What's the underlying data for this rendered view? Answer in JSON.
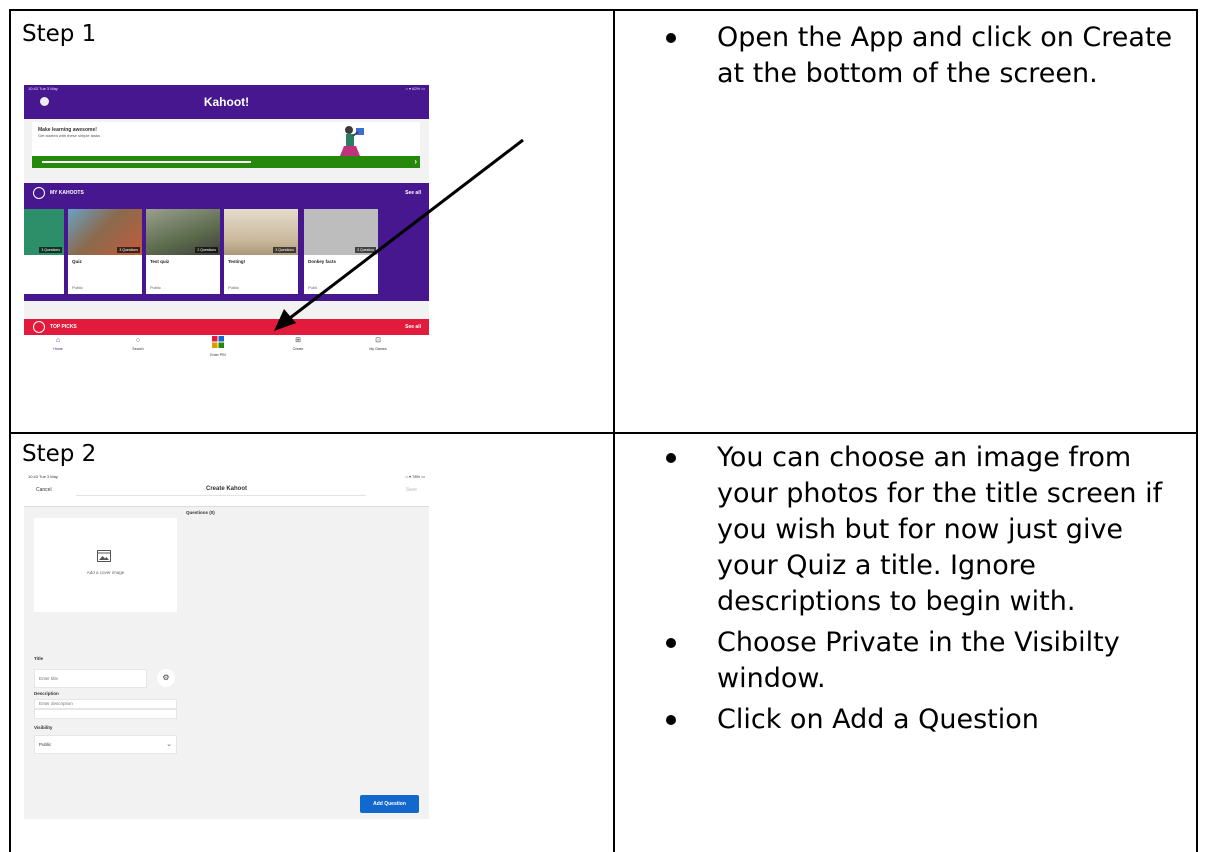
{
  "steps": [
    {
      "label": "Step 1",
      "bullets": [
        "Open the App and click on Create at the bottom of the screen."
      ]
    },
    {
      "label": "Step 2",
      "bullets": [
        "You can choose an image from your photos for the title screen if you wish but for now just give your Quiz a title. Ignore descriptions to begin with.",
        "Choose Private in the Visibilty window.",
        "Click on Add a Question"
      ]
    }
  ],
  "shot1": {
    "status_time": "10:43  Tue 3 May",
    "status_right": "⌂ ▾ 62% ▭",
    "logo": "Kahoot!",
    "card_title": "Make learning awesome!",
    "card_subtitle": "Get started with these simple tasks",
    "progress": 0.58,
    "section_title": "MY KAHOOTS",
    "see_all": "See all",
    "tiles": [
      {
        "name": "",
        "badge": "3 Questions",
        "visibility": "",
        "color": "#2c8f6a"
      },
      {
        "name": "Quiz",
        "badge": "3 Questions",
        "visibility": "Public",
        "color": "#8a6a4d"
      },
      {
        "name": "Test quiz",
        "badge": "2 Questions",
        "visibility": "Public",
        "color": "#6f7565"
      },
      {
        "name": "Testing!",
        "badge": "3 Questions",
        "visibility": "Public",
        "color": "#c9b79a"
      },
      {
        "name": "Donkey facts",
        "badge": "3 Question",
        "visibility": "Publi",
        "color": "#bdbdbd"
      }
    ],
    "top_picks_title": "TOP PICKS",
    "top_picks_see_all": "See all",
    "nav": [
      {
        "label": "Home",
        "icon": "home-icon",
        "glyph": "⌂"
      },
      {
        "label": "Search",
        "icon": "search-icon",
        "glyph": "○"
      },
      {
        "label": "Enter PIN",
        "icon": "pin-icon",
        "glyph": "■"
      },
      {
        "label": "Create",
        "icon": "create-icon",
        "glyph": "⊞"
      },
      {
        "label": "My Games",
        "icon": "games-icon",
        "glyph": "⊡"
      }
    ]
  },
  "shot2": {
    "status_time": "10:43  Tue 3 May",
    "status_right": "⌂ ▾ 78% ▭",
    "cancel": "Cancel",
    "title": "Create Kahoot",
    "save": "Save",
    "questions": "Questions (0)",
    "cover_label": "Add a cover image",
    "title_label": "Title",
    "title_placeholder": "Enter title",
    "description_label": "Description",
    "description_placeholder": "Enter description",
    "visibility_label": "Visibility",
    "visibility_value": "Public",
    "add_question": "Add Question"
  }
}
